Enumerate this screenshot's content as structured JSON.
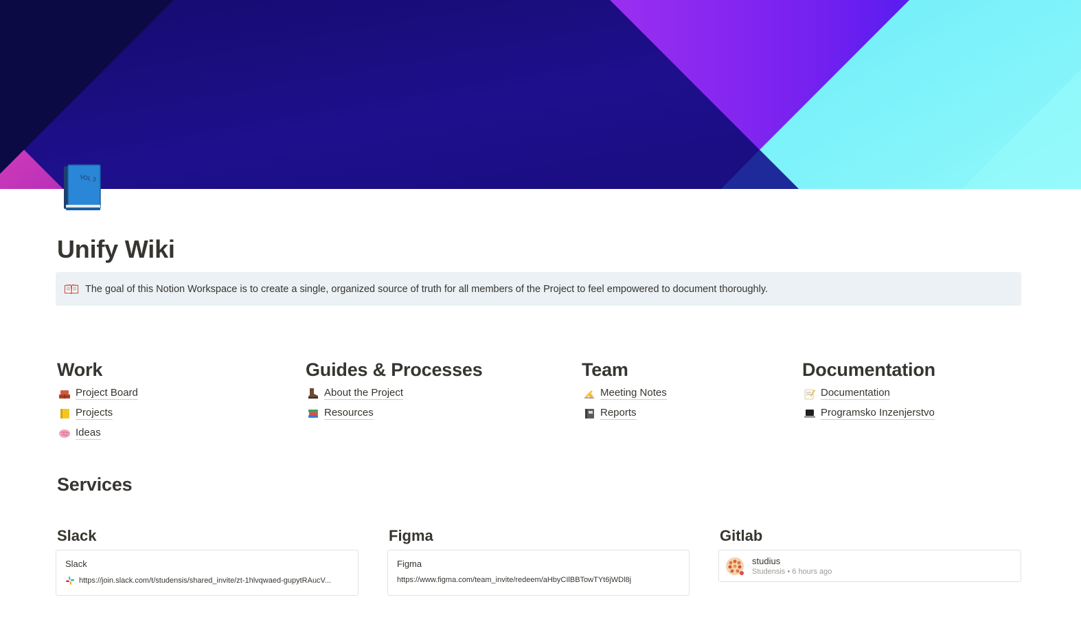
{
  "page": {
    "title": "Unify Wiki",
    "icon": "blue-book-icon",
    "icon_text": "VOL 3"
  },
  "callout": {
    "icon": "open-book-icon",
    "text": "The goal of this Notion Workspace is to create a single, organized source of truth for all members of the Project to feel empowered to document thoroughly."
  },
  "columns": [
    {
      "heading": "Work",
      "links": [
        {
          "icon": "bricks-icon",
          "label": "Project Board"
        },
        {
          "icon": "notebook-icon",
          "label": "Projects"
        },
        {
          "icon": "brain-icon",
          "label": "Ideas"
        }
      ]
    },
    {
      "heading": "Guides & Processes",
      "links": [
        {
          "icon": "boot-icon",
          "label": "About the Project"
        },
        {
          "icon": "books-icon",
          "label": "Resources"
        }
      ]
    },
    {
      "heading": "Team",
      "links": [
        {
          "icon": "writing-hand-icon",
          "label": "Meeting Notes"
        },
        {
          "icon": "notebook-with-cover-icon",
          "label": "Reports"
        }
      ]
    },
    {
      "heading": "Documentation",
      "links": [
        {
          "icon": "memo-icon",
          "label": "Documentation"
        },
        {
          "icon": "laptop-icon",
          "label": "Programsko Inzenjerstvo"
        }
      ]
    }
  ],
  "services": {
    "title": "Services",
    "items": [
      {
        "heading": "Slack",
        "type": "bookmark",
        "title": "Slack",
        "url": "https://join.slack.com/t/studensis/shared_invite/zt-1hlvqwaed-gupytRAucV...",
        "favicon": "slack-icon"
      },
      {
        "heading": "Figma",
        "type": "bookmark",
        "title": "Figma",
        "url": "https://www.figma.com/team_invite/redeem/aHbyCIlBBTowTYt6jWDl8j"
      },
      {
        "heading": "Gitlab",
        "type": "mention",
        "name": "studius",
        "meta": "Studensis • 6 hours ago",
        "avatar": "gitlab-avatar-icon"
      }
    ]
  },
  "colors": {
    "cover_dark": "#0b0a45",
    "cover_indigo": "#1e0f8c",
    "cover_purple": "#8a2cf2",
    "cover_cyan": "#79f3fa",
    "cover_pink": "#c43ab7",
    "callout_bg": "#ebf1f4",
    "text": "#37352f"
  }
}
